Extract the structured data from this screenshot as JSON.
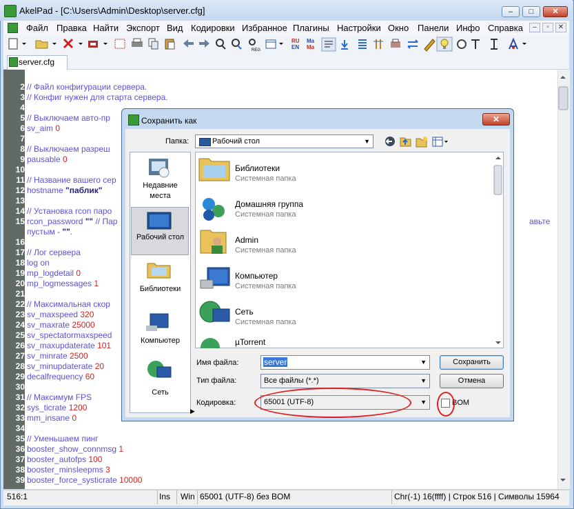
{
  "window": {
    "title": "AkelPad - [C:\\Users\\Admin\\Desktop\\server.cfg]",
    "controls": [
      "–",
      "□",
      "✕"
    ]
  },
  "menu": [
    "Файл",
    "Правка",
    "Найти",
    "Экспорт",
    "Вид",
    "Кодировки",
    "Избранное",
    "Плагины",
    "Настройки",
    "Окно",
    "Панели",
    "Инфо",
    "Справка"
  ],
  "mdi_controls": [
    "–",
    "▫",
    "✕"
  ],
  "toolbar_glyph_labels": {
    "run": "RU",
    "en": "EN",
    "ma1": "Ma",
    "ma2": "Ma",
    "reg": "REG"
  },
  "tab": {
    "label": "server.cfg"
  },
  "editor": {
    "lines": [
      {
        "n": "",
        "parts": []
      },
      {
        "n": "2",
        "parts": [
          {
            "k": "c",
            "t": "// Файл конфигурации сервера."
          }
        ]
      },
      {
        "n": "3",
        "parts": [
          {
            "k": "c",
            "t": "// Конфиг нужен для старта сервера."
          }
        ]
      },
      {
        "n": "4",
        "parts": []
      },
      {
        "n": "5",
        "parts": [
          {
            "k": "c",
            "t": "// Выключаем авто-пр"
          }
        ]
      },
      {
        "n": "6",
        "parts": [
          {
            "k": "c",
            "t": "sv_aim "
          },
          {
            "k": "v",
            "t": "0"
          }
        ]
      },
      {
        "n": "7",
        "parts": []
      },
      {
        "n": "8",
        "parts": [
          {
            "k": "c",
            "t": "// Выключаем разреш"
          }
        ]
      },
      {
        "n": "9",
        "parts": [
          {
            "k": "c",
            "t": "pausable "
          },
          {
            "k": "v",
            "t": "0"
          }
        ]
      },
      {
        "n": "10",
        "parts": []
      },
      {
        "n": "11",
        "parts": [
          {
            "k": "c",
            "t": "// Название вашего сер"
          }
        ]
      },
      {
        "n": "12",
        "parts": [
          {
            "k": "c",
            "t": "hostname "
          },
          {
            "k": "s",
            "t": "\"паблик\""
          }
        ]
      },
      {
        "n": "13",
        "parts": []
      },
      {
        "n": "14",
        "parts": [
          {
            "k": "c",
            "t": "// Установка rcon паро"
          }
        ]
      },
      {
        "n": "15",
        "parts": [
          {
            "k": "c",
            "t": "rcon_password "
          },
          {
            "k": "s",
            "t": "\"\""
          },
          {
            "k": "c",
            "t": " // Пар"
          }
        ]
      },
      {
        "n": "",
        "parts": [
          {
            "k": "c",
            "t": "пустым - "
          },
          {
            "k": "s",
            "t": "\"\""
          },
          {
            "k": "c",
            "t": "."
          }
        ]
      },
      {
        "n": "16",
        "parts": []
      },
      {
        "n": "17",
        "parts": [
          {
            "k": "c",
            "t": "// Лог сервера"
          }
        ]
      },
      {
        "n": "18",
        "parts": [
          {
            "k": "c",
            "t": "log on"
          }
        ]
      },
      {
        "n": "19",
        "parts": [
          {
            "k": "c",
            "t": "mp_logdetail "
          },
          {
            "k": "v",
            "t": "0"
          }
        ]
      },
      {
        "n": "20",
        "parts": [
          {
            "k": "c",
            "t": "mp_logmessages "
          },
          {
            "k": "v",
            "t": "1"
          }
        ]
      },
      {
        "n": "21",
        "parts": []
      },
      {
        "n": "22",
        "parts": [
          {
            "k": "c",
            "t": "// Максимальная скор"
          }
        ]
      },
      {
        "n": "23",
        "parts": [
          {
            "k": "c",
            "t": "sv_maxspeed "
          },
          {
            "k": "v",
            "t": "320"
          }
        ]
      },
      {
        "n": "24",
        "parts": [
          {
            "k": "c",
            "t": "sv_maxrate "
          },
          {
            "k": "v",
            "t": "25000"
          }
        ]
      },
      {
        "n": "25",
        "parts": [
          {
            "k": "c",
            "t": "sv_spectatormaxspeed"
          }
        ]
      },
      {
        "n": "26",
        "parts": [
          {
            "k": "c",
            "t": "sv_maxupdaterate "
          },
          {
            "k": "v",
            "t": "101"
          }
        ]
      },
      {
        "n": "27",
        "parts": [
          {
            "k": "c",
            "t": "sv_minrate "
          },
          {
            "k": "v",
            "t": "2500"
          }
        ]
      },
      {
        "n": "28",
        "parts": [
          {
            "k": "c",
            "t": "sv_minupdaterate "
          },
          {
            "k": "v",
            "t": "20"
          }
        ]
      },
      {
        "n": "29",
        "parts": [
          {
            "k": "c",
            "t": "decalfrequency "
          },
          {
            "k": "v",
            "t": "60"
          }
        ]
      },
      {
        "n": "30",
        "parts": []
      },
      {
        "n": "31",
        "parts": [
          {
            "k": "c",
            "t": "// Максимум FPS"
          }
        ]
      },
      {
        "n": "32",
        "parts": [
          {
            "k": "c",
            "t": "sys_ticrate "
          },
          {
            "k": "v",
            "t": "1200"
          }
        ]
      },
      {
        "n": "33",
        "parts": [
          {
            "k": "c",
            "t": "mm_insane "
          },
          {
            "k": "v",
            "t": "0"
          }
        ]
      },
      {
        "n": "34",
        "parts": []
      },
      {
        "n": "35",
        "parts": [
          {
            "k": "c",
            "t": "// Уменьшаем пинг"
          }
        ]
      },
      {
        "n": "36",
        "parts": [
          {
            "k": "c",
            "t": "booster_show_connmsg "
          },
          {
            "k": "v",
            "t": "1"
          }
        ]
      },
      {
        "n": "37",
        "parts": [
          {
            "k": "c",
            "t": "booster_autofps "
          },
          {
            "k": "v",
            "t": "100"
          }
        ]
      },
      {
        "n": "38",
        "parts": [
          {
            "k": "c",
            "t": "booster_minsleepms "
          },
          {
            "k": "v",
            "t": "3"
          }
        ]
      },
      {
        "n": "39",
        "parts": [
          {
            "k": "c",
            "t": "booster_force_systicrate "
          },
          {
            "k": "v",
            "t": "10000"
          }
        ]
      }
    ],
    "right_fragment": "авьте"
  },
  "status": {
    "position": "516:1",
    "mode": "Ins",
    "newline": "Win",
    "encoding": "65001 (UTF-8) без BOM",
    "info": "Chr(-1) 16(ffff) | Строк 516 | Символы 15964"
  },
  "dialog": {
    "title": "Сохранить как",
    "folder_label": "Папка:",
    "folder_value": "Рабочий стол",
    "places": [
      {
        "label1": "Недавние",
        "label2": "места"
      },
      {
        "label1": "Рабочий стол",
        "label2": ""
      },
      {
        "label1": "Библиотеки",
        "label2": ""
      },
      {
        "label1": "Компьютер",
        "label2": ""
      },
      {
        "label1": "Сеть",
        "label2": ""
      }
    ],
    "files": [
      {
        "name": "Библиотеки",
        "sub": "Системная папка"
      },
      {
        "name": "Домашняя группа",
        "sub": "Системная папка"
      },
      {
        "name": "Admin",
        "sub": "Системная папка"
      },
      {
        "name": "Компьютер",
        "sub": "Системная папка"
      },
      {
        "name": "Сеть",
        "sub": "Системная папка"
      },
      {
        "name": "µTorrent",
        "sub": ""
      }
    ],
    "filename_label": "Имя файла:",
    "filename_value": "server",
    "filetype_label": "Тип файла:",
    "filetype_value": "Все файлы (*.*)",
    "encoding_label": "Кодировка:",
    "encoding_value": "65001 (UTF-8)",
    "bom_label": "BOM",
    "save_label": "Сохранить",
    "cancel_label": "Отмена"
  }
}
